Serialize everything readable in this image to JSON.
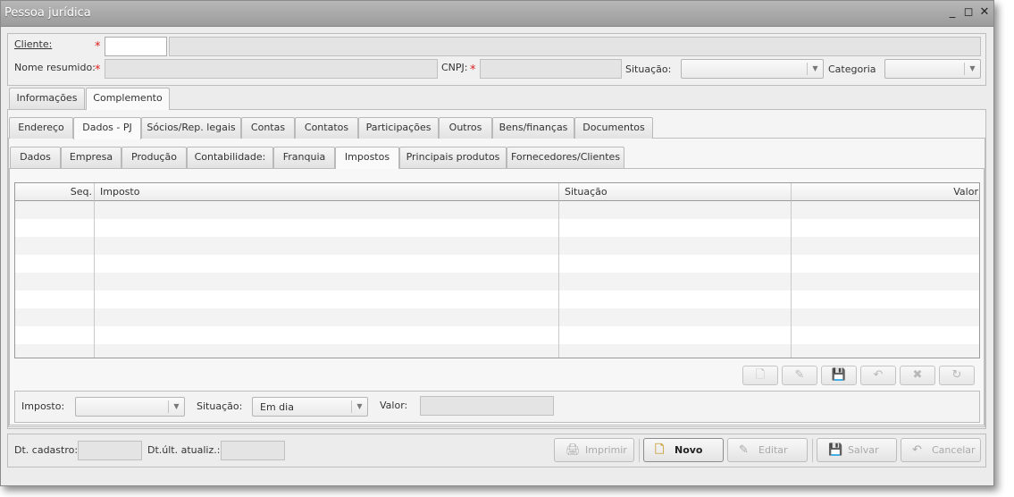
{
  "window": {
    "title": "Pessoa jurídica"
  },
  "header": {
    "cliente_label": "Cliente:",
    "nome_label": "Nome resumido:",
    "cnpj_label": "CNPJ:",
    "situacao_label": "Situação:",
    "categoria_label": "Categoria",
    "required_mark": "*"
  },
  "top_tabs": [
    "Informações",
    "Complemento"
  ],
  "second_tabs": [
    "Endereço",
    "Dados - PJ",
    "Sócios/Rep. legais",
    "Contas",
    "Contatos",
    "Participações",
    "Outros",
    "Bens/finanças",
    "Documentos"
  ],
  "third_tabs": [
    "Dados",
    "Empresa",
    "Produção",
    "Contabilidade:",
    "Franquia",
    "Impostos",
    "Principais produtos",
    "Fornecedores/Clientes"
  ],
  "grid": {
    "columns": [
      "Seq.",
      "Imposto",
      "Situação",
      "Valor"
    ]
  },
  "edit_form": {
    "imposto_label": "Imposto:",
    "situacao_label": "Situação:",
    "situacao_value": "Em dia",
    "valor_label": "Valor:"
  },
  "footer": {
    "dt_cadastro_label": "Dt. cadastro:",
    "dt_atualiz_label": "Dt.últ. atualiz.:",
    "imprimir": "Imprimir",
    "novo": "Novo",
    "editar": "Editar",
    "salvar": "Salvar",
    "cancelar": "Cancelar"
  }
}
